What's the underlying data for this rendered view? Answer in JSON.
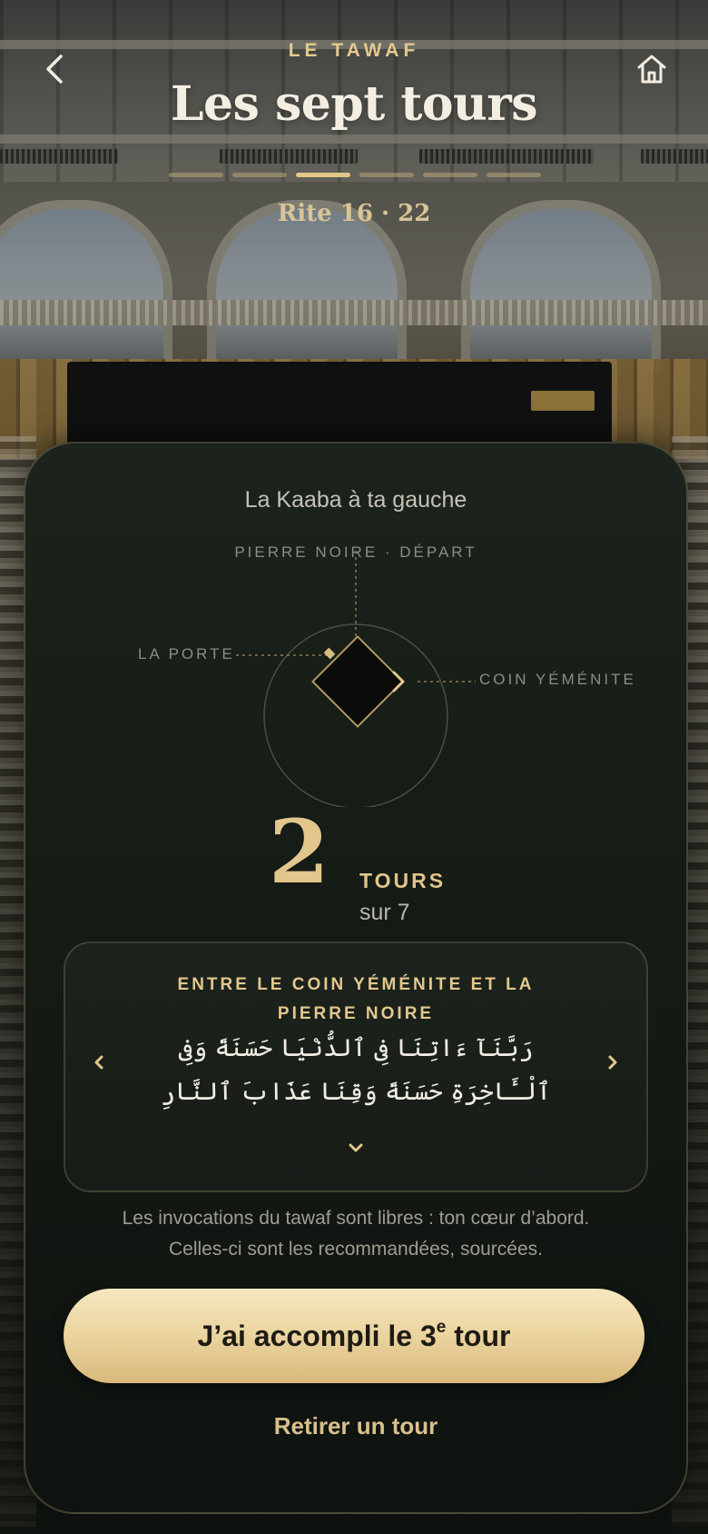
{
  "header": {
    "kicker": "LE TAWAF",
    "title": "Les sept tours",
    "rite": "Rite 16 · 22",
    "back_icon": "chevron-left-icon",
    "home_icon": "home-icon",
    "progress": {
      "segments": 6,
      "active_index": 2
    }
  },
  "card": {
    "subtitle": "La Kaaba à ta gauche",
    "diagram": {
      "label_top": "PIERRE NOIRE · DÉPART",
      "label_left": "LA PORTE",
      "label_right": "COIN YÉMÉNITE"
    },
    "counter": {
      "value": "2",
      "unit": "TOURS",
      "of": "sur 7"
    },
    "dua": {
      "title": "ENTRE LE COIN YÉMÉNITE ET LA PIERRE NOIRE",
      "arabic": "رَبَّنَآ ءَاتِنَا فِى ٱلدُّنْيَا حَسَنَةً وَفِى ٱلْـَٔاخِرَةِ حَسَنَةً وَقِنَا عَذَابَ ٱلنَّارِ"
    },
    "note_line1": "Les invocations du tawaf sont libres : ton cœur d’abord.",
    "note_line2": "Celles-ci sont les recommandées, sourcées.",
    "cta_prefix": "J’ai accompli le 3",
    "cta_sup": "e",
    "cta_suffix": " tour",
    "secondary": "Retirer un tour"
  },
  "colors": {
    "gold": "#e3c78d",
    "cta_gradient_top": "#f6e7c0",
    "cta_gradient_bottom": "#d9b97c",
    "card_bg": "#151b15"
  }
}
